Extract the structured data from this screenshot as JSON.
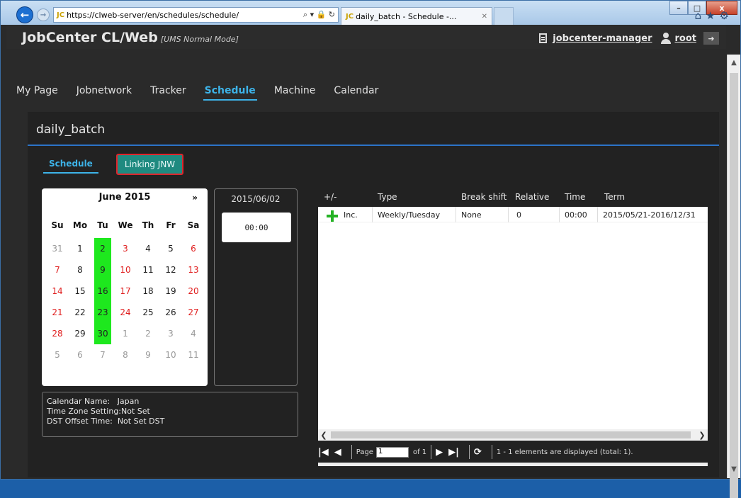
{
  "browser": {
    "address": "https://clweb-server/en/schedules/schedule/",
    "tab_title": "daily_batch - Schedule -...",
    "favicon_text": "JC",
    "winbtns": [
      "–",
      "□",
      "x"
    ]
  },
  "app": {
    "title": "JobCenter CL/Web",
    "mode": "[UMS Normal Mode]",
    "server": "jobcenter-manager",
    "user": "root"
  },
  "menu": [
    "My Page",
    "Jobnetwork",
    "Tracker",
    "Schedule",
    "Machine",
    "Calendar"
  ],
  "panel": {
    "title": "daily_batch",
    "subtab_schedule": "Schedule",
    "subtab_linking": "Linking JNW"
  },
  "calendar": {
    "month": "June 2015",
    "next": "»",
    "dow": [
      "Su",
      "Mo",
      "Tu",
      "We",
      "Th",
      "Fr",
      "Sa"
    ],
    "weeks": [
      [
        "31",
        "1",
        "2",
        "3",
        "4",
        "5",
        "6"
      ],
      [
        "7",
        "8",
        "9",
        "10",
        "11",
        "12",
        "13"
      ],
      [
        "14",
        "15",
        "16",
        "17",
        "18",
        "19",
        "20"
      ],
      [
        "21",
        "22",
        "23",
        "24",
        "25",
        "26",
        "27"
      ],
      [
        "28",
        "29",
        "30",
        "1",
        "2",
        "3",
        "4"
      ],
      [
        "5",
        "6",
        "7",
        "8",
        "9",
        "10",
        "11"
      ]
    ],
    "selected_days": [
      "2",
      "9",
      "16",
      "23",
      "30"
    ],
    "selected_color": "#1ee81e"
  },
  "selected_date": "2015/06/02",
  "selected_time": "00:00",
  "info": {
    "line1": "Calendar Name:   Japan",
    "line2": "Time Zone Setting:Not Set",
    "line3": "DST Offset Time:  Not Set DST"
  },
  "grid": {
    "headers": [
      "+/-",
      "Type",
      "Break shift",
      "Relative",
      "Time",
      "Term"
    ],
    "rows": [
      {
        "pm": "Inc.",
        "type": "Weekly/Tuesday",
        "break_shift": "None",
        "relative": "0",
        "time": "00:00",
        "term": "2015/05/21-2016/12/31"
      }
    ]
  },
  "pager": {
    "page_label": "Page",
    "page_value": "1",
    "of_label": "of 1",
    "status": "1 - 1 elements are displayed (total: 1)."
  },
  "colors": {
    "accent": "#3db3e8",
    "linking_button": "#1f8a80",
    "highlight_border": "#e0242b",
    "header_bg": "#2c2c2c"
  }
}
